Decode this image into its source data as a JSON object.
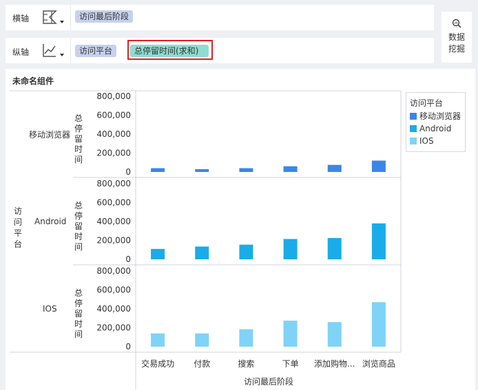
{
  "toolbar": {
    "x_axis_label": "横轴",
    "y_axis_label": "纵轴",
    "x_field": "访问最后阶段",
    "y_field_dimension": "访问平台",
    "y_field_measure": "总停留时间(求和)",
    "x_chart_icon": "bar-chart-type-icon",
    "y_chart_icon": "line-chart-type-icon",
    "data_mining_line1": "数据",
    "data_mining_line2": "挖掘",
    "data_mining_icon": "data-mining-icon"
  },
  "component": {
    "title": "未命名组件"
  },
  "colors": {
    "mobile": "#3a86e8",
    "android": "#1aace8",
    "ios": "#7fd3f7",
    "selected_outline": "#e02020"
  },
  "chart_data": {
    "type": "bar",
    "categories": [
      "交易成功",
      "付款",
      "搜索",
      "下单",
      "添加购物...",
      "浏览商品"
    ],
    "xlabel": "访问最后阶段",
    "row_dimension_label": "访问平台",
    "panel_ylabel": "总停留时间",
    "ylim": [
      0,
      800000
    ],
    "y_ticks": [
      "800,000",
      "600,000",
      "400,000",
      "200,000",
      "0"
    ],
    "series": [
      {
        "name": "移动浏览器",
        "values": [
          40000,
          30000,
          40000,
          60000,
          75000,
          120000
        ]
      },
      {
        "name": "Android",
        "values": [
          110000,
          135000,
          155000,
          215000,
          225000,
          380000
        ]
      },
      {
        "name": "IOS",
        "values": [
          140000,
          140000,
          185000,
          275000,
          260000,
          470000
        ]
      }
    ],
    "legend": {
      "title": "访问平台",
      "position": "right",
      "items": [
        "移动浏览器",
        "Android",
        "IOS"
      ]
    }
  }
}
